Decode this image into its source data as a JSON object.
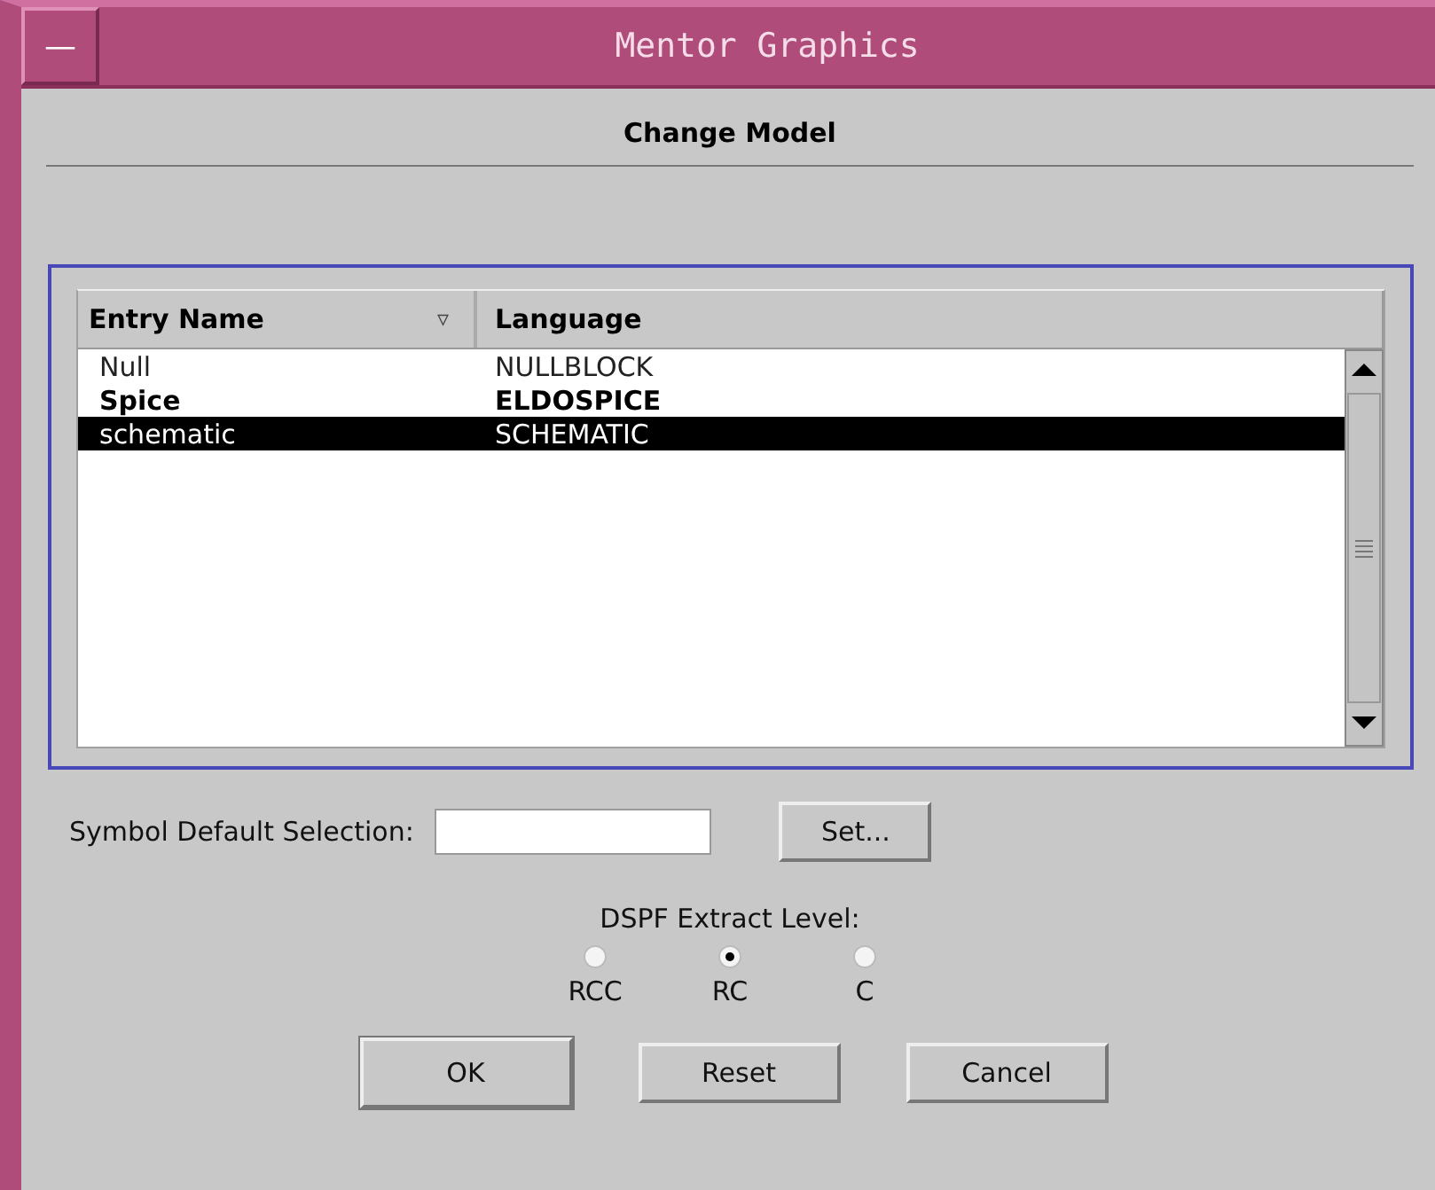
{
  "window": {
    "title": "Mentor Graphics",
    "menu_button": "—"
  },
  "dialog": {
    "heading": "Change Model"
  },
  "table": {
    "columns": [
      {
        "label": "Entry Name",
        "sort_indicator": "▿"
      },
      {
        "label": "Language"
      }
    ],
    "rows": [
      {
        "cells": [
          "Null",
          "NULLBLOCK"
        ],
        "bold": false,
        "selected": false
      },
      {
        "cells": [
          "Spice",
          "ELDOSPICE"
        ],
        "bold": true,
        "selected": false
      },
      {
        "cells": [
          "schematic",
          "SCHEMATIC"
        ],
        "bold": false,
        "selected": true
      }
    ]
  },
  "symbol_default_selection": {
    "label": "Symbol Default Selection:",
    "button": "Set..."
  },
  "dspf_extract_level": {
    "label": "DSPF Extract Level:",
    "options": [
      {
        "label": "RCC",
        "selected": false
      },
      {
        "label": "RC",
        "selected": true
      },
      {
        "label": "C",
        "selected": false
      }
    ]
  },
  "buttons": [
    {
      "label": "OK",
      "default": true
    },
    {
      "label": "Reset",
      "default": false
    },
    {
      "label": "Cancel",
      "default": false
    }
  ]
}
